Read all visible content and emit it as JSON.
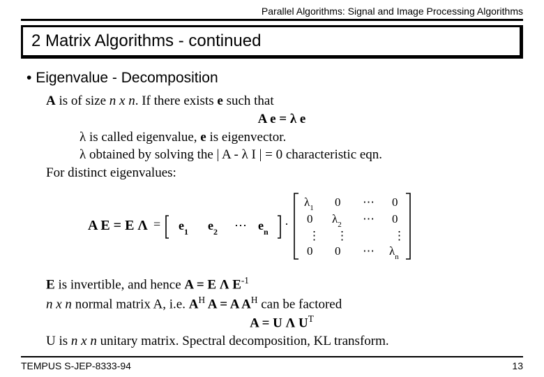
{
  "header": "Parallel Algorithms:  Signal and Image Processing Algorithms",
  "title": "2  Matrix Algorithms - continued",
  "bullet1": "Eigenvalue - Decomposition",
  "line1_pre": "A",
  "line1_mid": "  is of size ",
  "line1_nxn": "n x n",
  "line1_post": ". If there exists ",
  "line1_e": "e",
  "line1_end": "  such that",
  "eq1": "A e = λ e",
  "line2": "λ is called eigenvalue, ",
  "line2_e": "e",
  "line2_post": " is eigenvector.",
  "line3": "λ obtained by solving  the | A - λ I |  =  0     characteristic eqn.",
  "line4": "For distinct eigenvalues:",
  "matrix_label": "A E = E Λ",
  "chart_data": {
    "type": "matrix",
    "rowvector": [
      "e₁",
      "e₂",
      "⋯",
      "eₙ"
    ],
    "diagonal": [
      "λ₁",
      "λ₂",
      "⋯",
      "λₙ"
    ],
    "matrix_repr": [
      [
        "λ₁",
        "0",
        "⋯",
        "0"
      ],
      [
        "0",
        "λ₂",
        "⋯",
        "0"
      ],
      [
        "⋮",
        "⋮",
        "",
        "⋮"
      ],
      [
        "0",
        "0",
        "⋯",
        "λₙ"
      ]
    ]
  },
  "line5_pre": "E",
  "line5_mid": "  is invertible, and hence ",
  "line5_eq": "A = E Λ E",
  "line5_sup": "-1",
  "line6_pre": "n x n",
  "line6_mid": " normal matrix A, i.e. ",
  "line6_eq1": "A",
  "line6_H": "H",
  "line6_eq2": " A = A A",
  "line6_post": "   can be factored",
  "eq2_pre": "A = U Λ U",
  "eq2_sup": "T",
  "line7": "U is ",
  "line7_nxn": "n x n",
  "line7_post": " unitary matrix. Spectral decomposition, KL transform.",
  "footer_left": "TEMPUS S-JEP-8333-94",
  "footer_right": "13"
}
